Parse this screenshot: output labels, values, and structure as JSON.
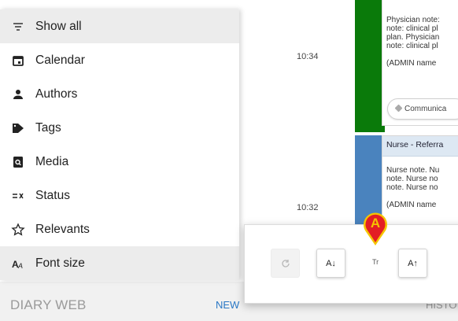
{
  "menu": {
    "items": [
      {
        "label": "Show all",
        "icon": "filter-icon",
        "active": true
      },
      {
        "label": "Calendar",
        "icon": "calendar-icon",
        "active": false
      },
      {
        "label": "Authors",
        "icon": "person-icon",
        "active": false
      },
      {
        "label": "Tags",
        "icon": "tag-icon",
        "active": false
      },
      {
        "label": "Media",
        "icon": "media-icon",
        "active": false
      },
      {
        "label": "Status",
        "icon": "status-icon",
        "active": false
      },
      {
        "label": "Relevants",
        "icon": "star-icon",
        "active": false
      },
      {
        "label": "Font size",
        "icon": "font-size-icon",
        "active": true
      }
    ]
  },
  "bottom": {
    "brand": "DIARY WEB",
    "new_label": "NEW",
    "history_label": "HISTO"
  },
  "timeline": {
    "entries": [
      {
        "time": "10:34",
        "bar_color": "#0a7a0a",
        "lines": [
          "Physician note:",
          "note: clinical pl",
          "plan. Physician",
          "note: clinical pl",
          "",
          "(ADMIN name"
        ],
        "chip": "Communica"
      },
      {
        "time": "10:32",
        "bar_color": "#4a83be",
        "header": "Nurse - Referra",
        "lines": [
          "Nurse note. Nu",
          "note. Nurse no",
          "note. Nurse no",
          "",
          "(ADMIN name"
        ]
      }
    ]
  },
  "font_popup": {
    "decrease_label": "A↓",
    "indicator_label": "Tr",
    "increase_label": "A↑"
  },
  "callout": {
    "letter": "A",
    "color": "#e31e24",
    "outline": "#f5c400"
  },
  "colors": {
    "active_bg": "#ececec",
    "link": "#2a78c5"
  }
}
